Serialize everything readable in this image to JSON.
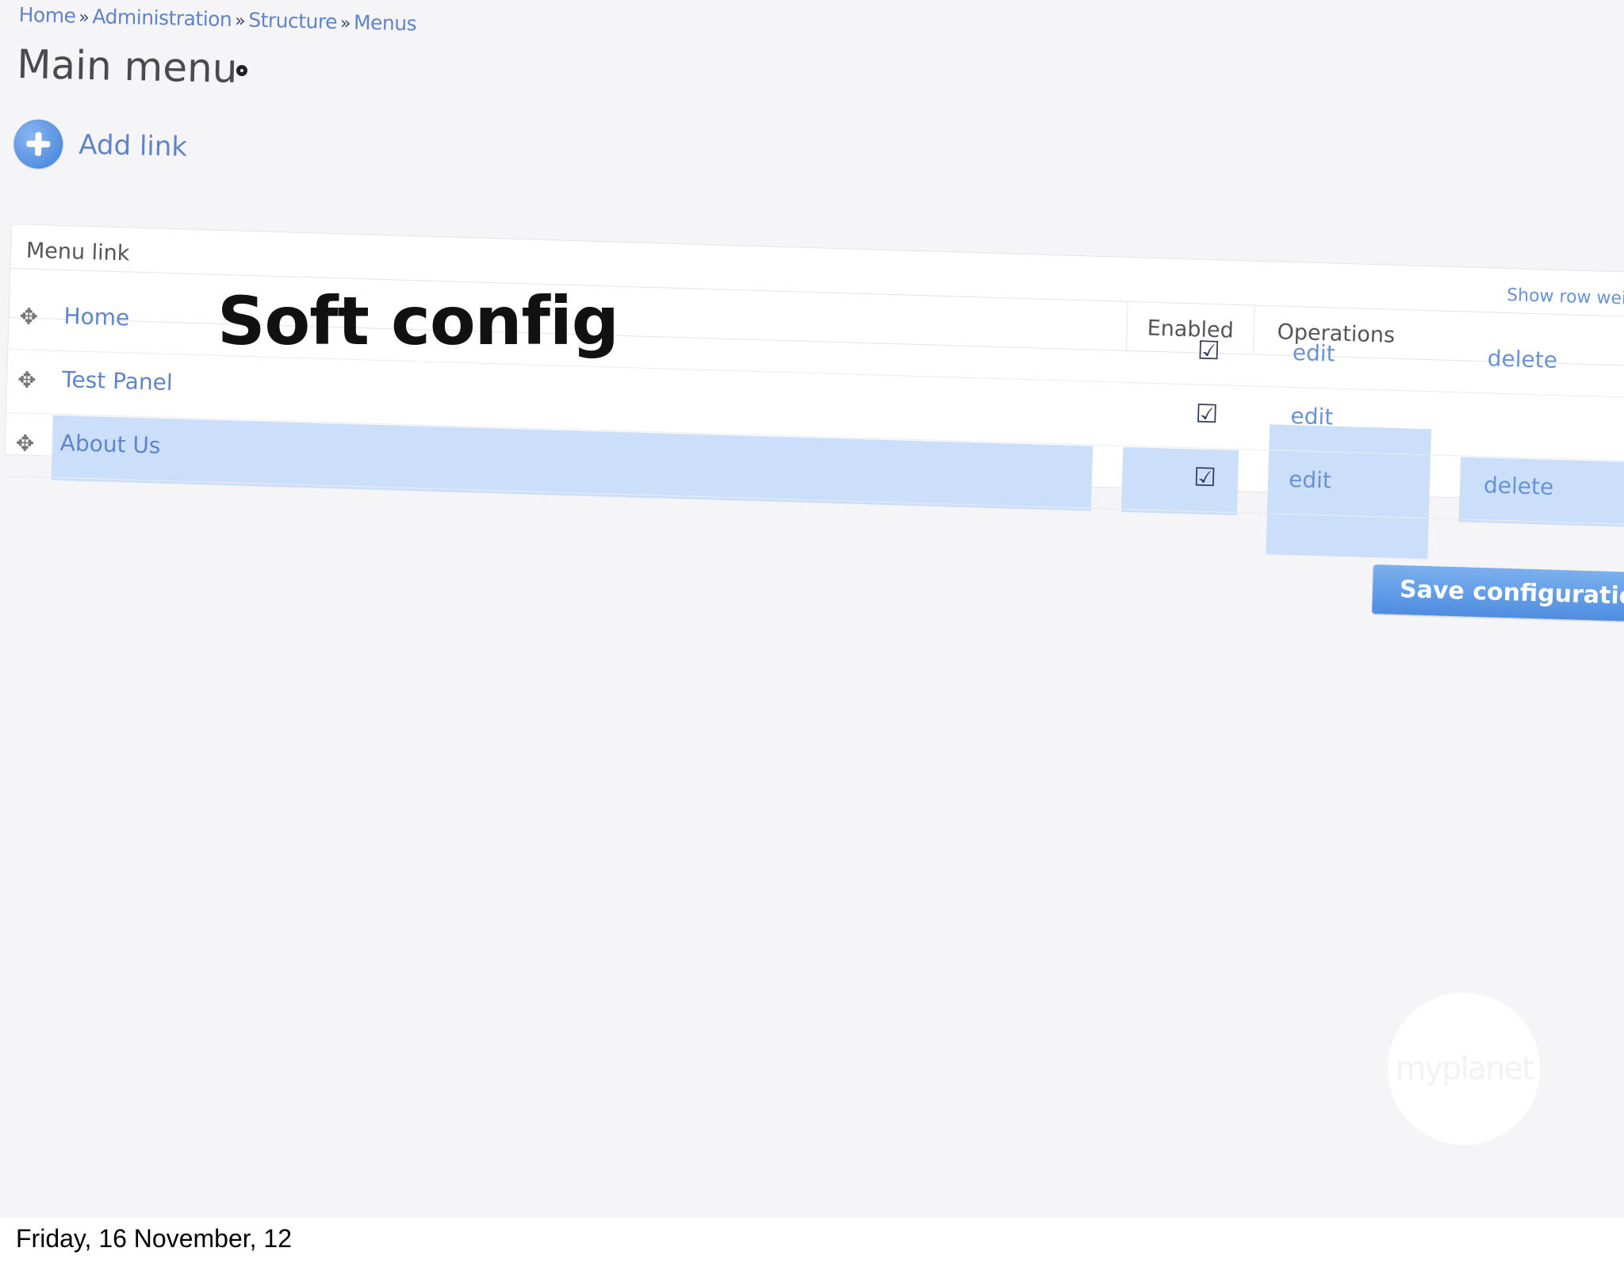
{
  "breadcrumb": {
    "items": [
      "Home",
      "Administration",
      "Structure",
      "Menus"
    ],
    "separator": "»"
  },
  "page": {
    "title": "Main menu",
    "add_link_label": "Add link"
  },
  "table": {
    "caption": "Menu link",
    "show_row_weights": "Show row wei",
    "headers": {
      "enabled": "Enabled",
      "operations": "Operations"
    },
    "rows": [
      {
        "title": "Home",
        "enabled": true,
        "edit": "edit",
        "delete": "delete"
      },
      {
        "title": "Test Panel",
        "enabled": true,
        "edit": "edit",
        "delete": ""
      },
      {
        "title": "About Us",
        "enabled": true,
        "edit": "edit",
        "delete": "delete"
      }
    ]
  },
  "save_button": "Save configuration",
  "overlay_title": "Soft config",
  "logo_text": "myplanet",
  "footer_date": "Friday, 16 November, 12",
  "colors": {
    "link": "#5f84c9",
    "highlight": "#c8dcfa",
    "button": "#5a95e3"
  }
}
